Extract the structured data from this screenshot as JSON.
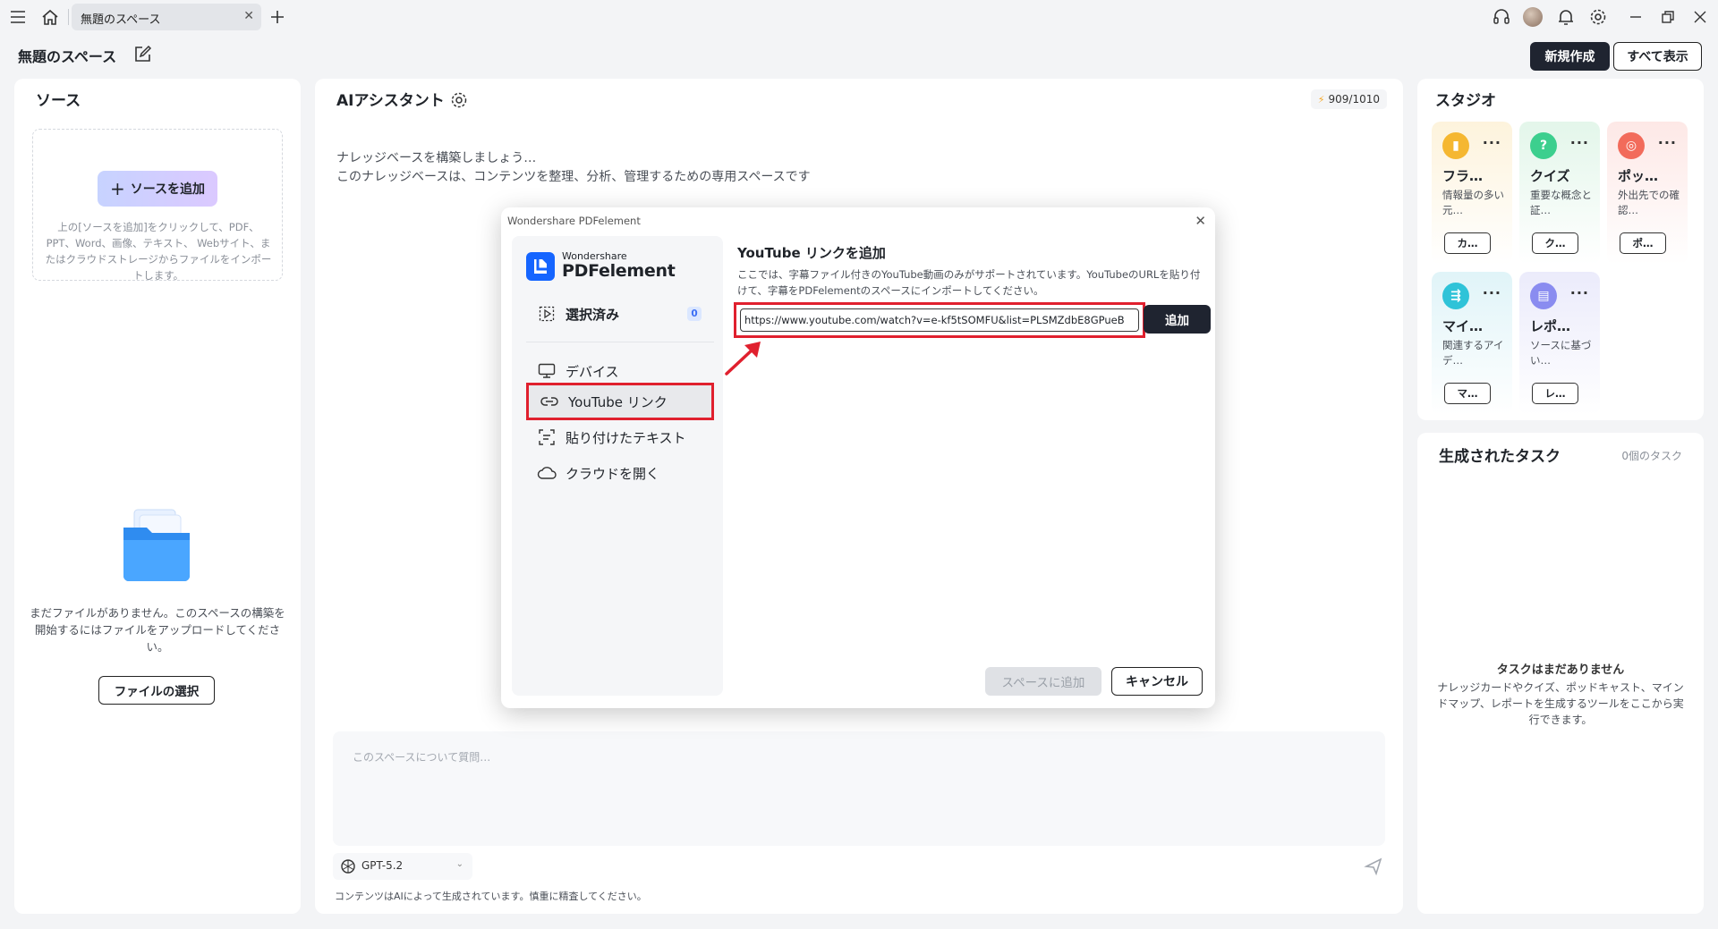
{
  "titlebar": {
    "tab_label": "無題のスペース",
    "icons": [
      "menu-icon",
      "home-icon",
      "close-icon",
      "plus-icon",
      "headset-icon",
      "avatar",
      "bell-icon",
      "gear-icon",
      "minimize-icon",
      "restore-icon",
      "close-window-icon"
    ]
  },
  "header": {
    "space_title": "無題のスペース",
    "new_button": "新規作成",
    "view_all_button": "すべて表示"
  },
  "sources": {
    "title": "ソース",
    "add_button": "ソースを追加",
    "add_hint": "上の[ソースを追加]をクリックして、PDF、PPT、Word、画像、テキスト、 Webサイト、またはクラウドストレージからファイルをインポートします。",
    "empty_message": "まだファイルがありません。このスペースの構築を開始するにはファイルをアップロードしてください。",
    "select_file_button": "ファイルの選択"
  },
  "assistant": {
    "title": "AIアシスタント",
    "credits": "909/1010",
    "intro_line1": "ナレッジベースを構築しましょう…",
    "intro_line2": "このナレッジベースは、コンテンツを整理、分析、管理するための専用スペースです",
    "chat_placeholder": "このスペースについて質問…",
    "model": "GPT-5.2",
    "disclaimer": "コンテンツはAIによって生成されています。慎重に精査してください。"
  },
  "studio": {
    "title": "スタジオ",
    "cards": [
      {
        "title": "フラ…",
        "desc": "情報量の多い元…",
        "button": "カ…",
        "icon": "flashcard-icon",
        "color": "#f5b731",
        "bg": "#fdf3dc"
      },
      {
        "title": "クイズ",
        "desc": "重要な概念と証…",
        "button": "ク…",
        "icon": "quiz-icon",
        "color": "#3ccf8e",
        "bg": "#e3f6ea"
      },
      {
        "title": "ポッ…",
        "desc": "外出先での確認…",
        "button": "ポ…",
        "icon": "podcast-icon",
        "color": "#f26b5b",
        "bg": "#fde8e6"
      },
      {
        "title": "マイ…",
        "desc": "関連するアイデ…",
        "button": "マ…",
        "icon": "mindmap-icon",
        "color": "#2fc3d8",
        "bg": "#e0f4f8"
      },
      {
        "title": "レポ…",
        "desc": "ソースに基づい…",
        "button": "レ…",
        "icon": "report-icon",
        "color": "#8a8cf0",
        "bg": "#ebebfb"
      }
    ]
  },
  "tasks": {
    "title": "生成されたタスク",
    "count": "0個のタスク",
    "empty_title": "タスクはまだありません",
    "empty_desc": "ナレッジカードやクイズ、ポッドキャスト、マインドマップ、レポートを生成するツールをここから実行できます。"
  },
  "modal": {
    "caption": "Wondershare PDFelement",
    "logo_small": "Wondershare",
    "logo_big": "PDFelement",
    "selected_label": "選択済み",
    "selected_count": "0",
    "menu": [
      {
        "label": "デバイス",
        "icon": "monitor-icon"
      },
      {
        "label": "YouTube リンク",
        "icon": "link-icon"
      },
      {
        "label": "貼り付けたテキスト",
        "icon": "paste-text-icon"
      },
      {
        "label": "クラウドを開く",
        "icon": "cloud-icon"
      }
    ],
    "youtube_title": "YouTube リンクを追加",
    "youtube_desc": "ここでは、字幕ファイル付きのYouTube動画のみがサポートされています。YouTubeのURLを貼り付けて、字幕をPDFelementのスペースにインポートしてください。",
    "url_value": "https://www.youtube.com/watch?v=e-kf5tSOMFU&list=PLSMZdbE8GPueB",
    "add_button": "追加",
    "add_to_space_button": "スペースに追加",
    "cancel_button": "キャンセル"
  }
}
